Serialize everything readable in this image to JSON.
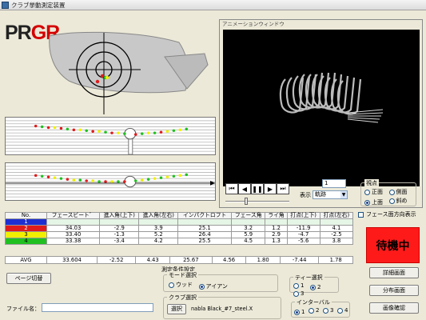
{
  "window": {
    "title": "クラブ挙動測定装置"
  },
  "logo": {
    "pr": "PR",
    "gr": "GR"
  },
  "animation": {
    "caption": "アニメーションウィンドウ",
    "interval_label": "インターバル",
    "interval_value": "1",
    "display_label": "表示",
    "display_value": "軌跡",
    "viewpoint": {
      "title": "視点",
      "options": [
        "正面",
        "側面",
        "上面",
        "斜め"
      ],
      "selected": "上面"
    }
  },
  "face_direction_checkbox": {
    "label": "フェース面方向表示",
    "checked": false
  },
  "table": {
    "headers": [
      "No.",
      "フェースビート゛",
      "進入角(上下)",
      "進入角(左右)",
      "インパクトロフト",
      "フェース角",
      "ライ角",
      "打点(上下)",
      "打点(左右)"
    ],
    "rows": [
      {
        "no": "1",
        "swatch": "blue",
        "values": [
          "",
          "",
          "",
          "",
          "",
          "",
          "",
          ""
        ]
      },
      {
        "no": "2",
        "swatch": "red",
        "values": [
          "34.03",
          "-2.9",
          "3.9",
          "25.1",
          "3.2",
          "1.2",
          "-11.9",
          "4.1"
        ]
      },
      {
        "no": "3",
        "swatch": "yellow",
        "values": [
          "33.40",
          "-1.3",
          "5.2",
          "26.4",
          "5.9",
          "2.9",
          "-4.7",
          "-2.5"
        ]
      },
      {
        "no": "4",
        "swatch": "green",
        "values": [
          "33.38",
          "-3.4",
          "4.2",
          "25.5",
          "4.5",
          "1.3",
          "-5.6",
          "3.8"
        ]
      }
    ],
    "avg": {
      "label": "AVG",
      "values": [
        "33.604",
        "-2.52",
        "4.43",
        "25.67",
        "4.56",
        "1.80",
        "-7.44",
        "1.78"
      ]
    }
  },
  "buttons": {
    "page_switch": "ページ切替",
    "select": "選択",
    "detail": "詳細画面",
    "distribution": "分布画面",
    "image_check": "画像確認"
  },
  "filename": {
    "label": "ファイル名：",
    "value": ""
  },
  "conditions": {
    "title": "測定条件設定",
    "mode": {
      "title": "モード選択",
      "options": [
        "ウッド",
        "アイアン"
      ],
      "selected": "アイアン"
    },
    "tee": {
      "title": "ティー選択",
      "options": [
        "1",
        "2",
        "3"
      ],
      "selected": "2"
    },
    "club": {
      "title": "クラブ選択",
      "value": "nabla Black_#7_steel.X"
    },
    "interval": {
      "title": "インターバル",
      "options": [
        "1",
        "2",
        "3",
        "4"
      ],
      "selected": "1"
    }
  },
  "status": {
    "text": "待機中",
    "color": "#ff1a1a"
  }
}
